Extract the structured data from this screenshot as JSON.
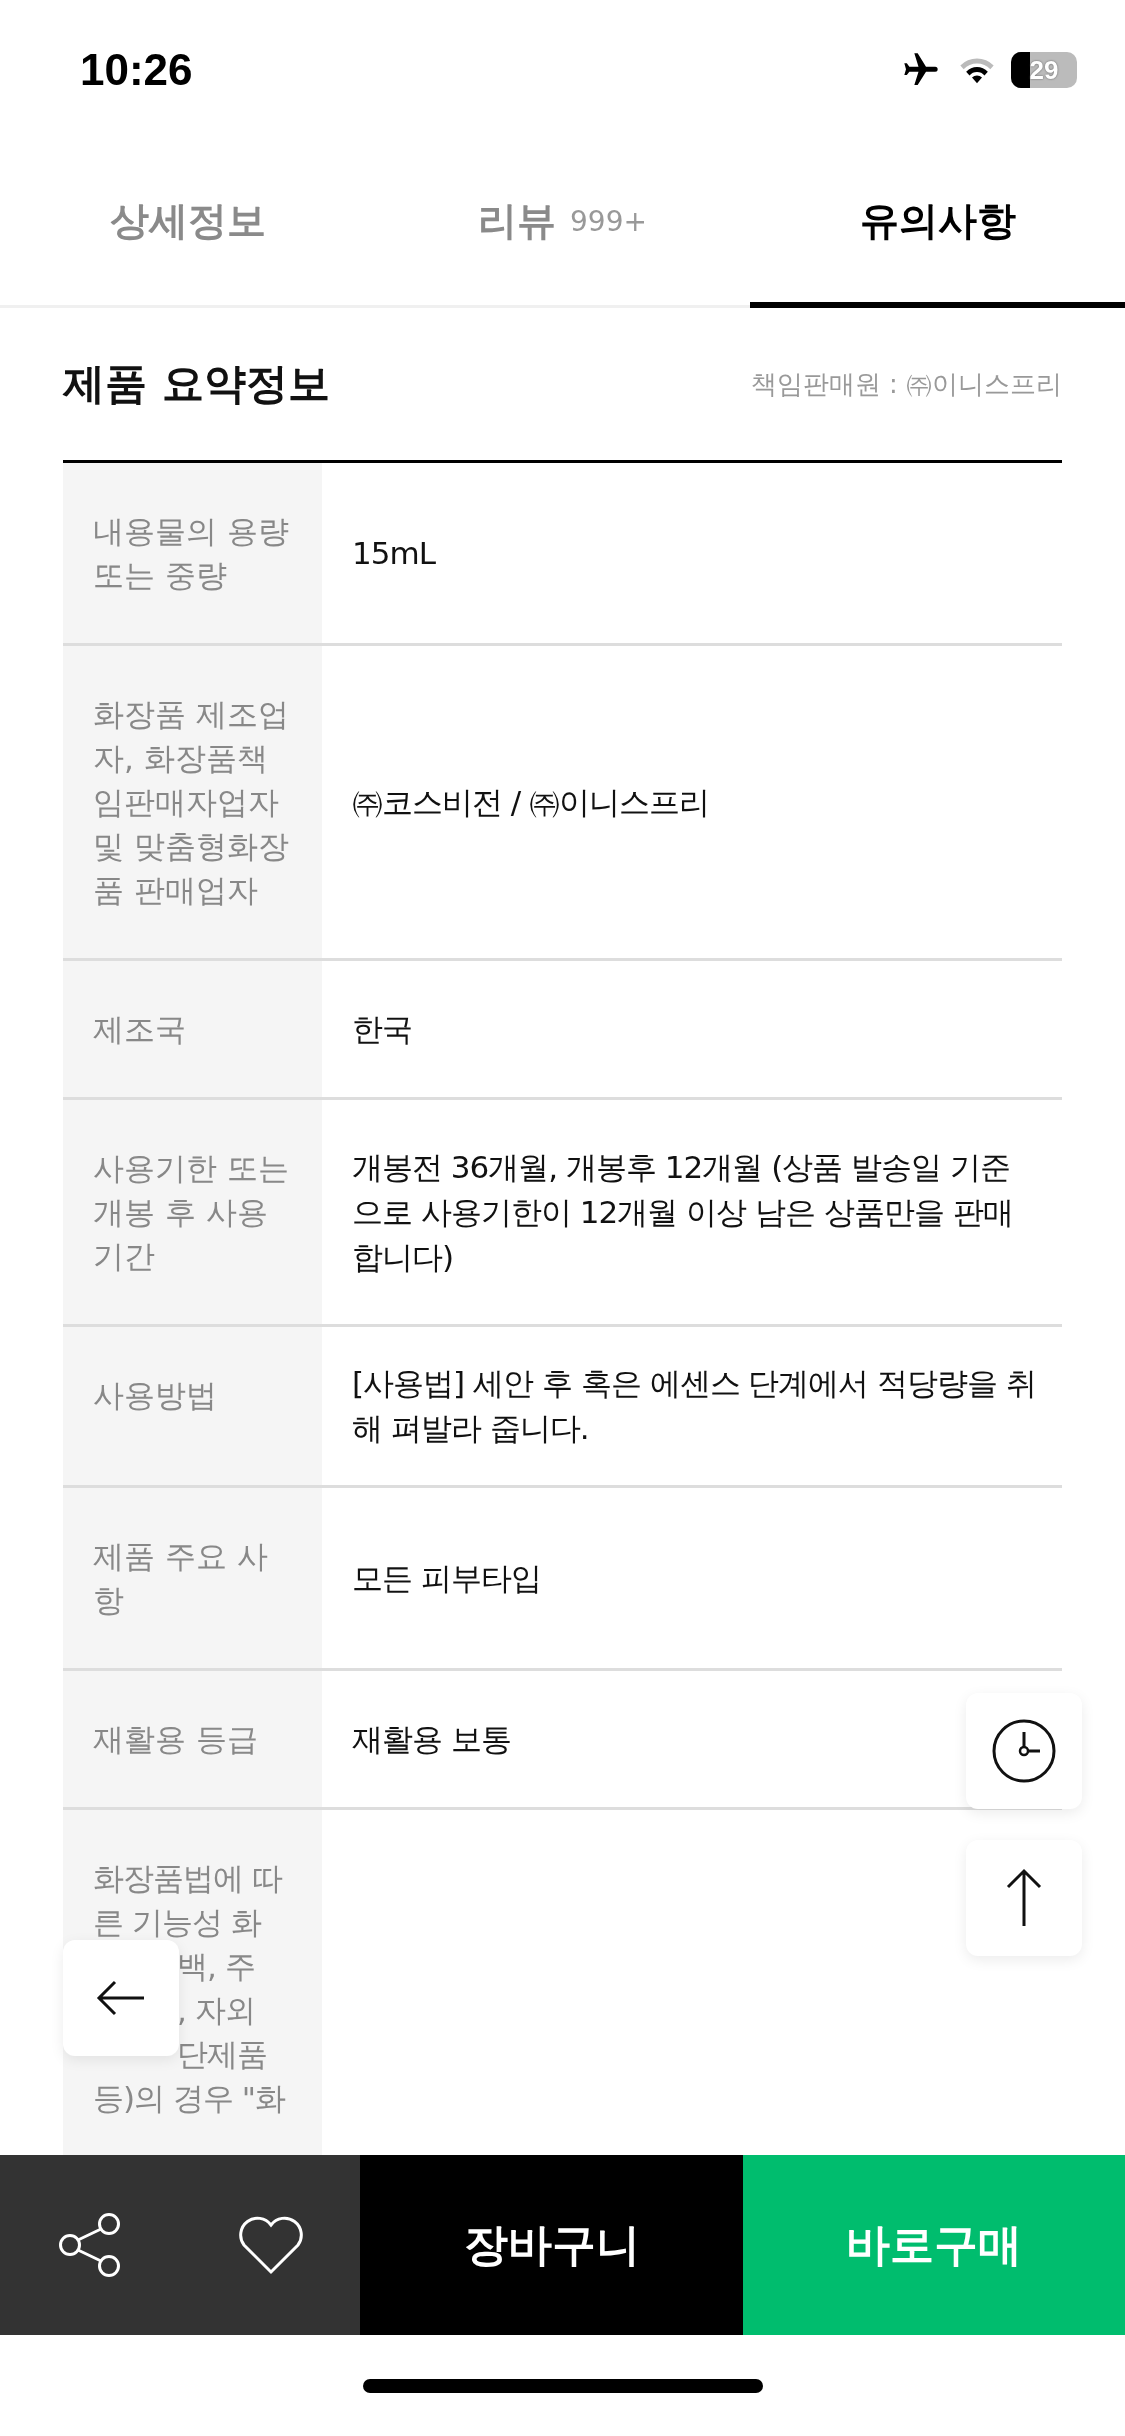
{
  "status_bar": {
    "time": "10:26",
    "battery": "29"
  },
  "tabs": [
    {
      "label": "상세정보",
      "selected": false
    },
    {
      "label": "리뷰",
      "count": "999+",
      "selected": false
    },
    {
      "label": "유의사항",
      "selected": true
    }
  ],
  "section": {
    "title": "제품 요약정보",
    "seller": "책임판매원 : ㈜이니스프리"
  },
  "rows": [
    {
      "label": [
        "내용물의 용량",
        "또는 중량"
      ],
      "value": "15mL"
    },
    {
      "label": [
        "화장품 제조업",
        "자, 화장품책",
        "임판매자업자",
        "및 맞춤형화장",
        "품 판매업자"
      ],
      "value": "㈜코스비전 / ㈜이니스프리"
    },
    {
      "label": [
        "제조국"
      ],
      "value": "한국"
    },
    {
      "label": [
        "사용기한 또는",
        "개봉 후 사용",
        "기간"
      ],
      "value": "개봉전 36개월, 개봉후 12개월 (상품 발송일 기준으로 사용기한이 12개월 이상 남은 상품만을 판매합니다)"
    },
    {
      "label": [
        "사용방법"
      ],
      "value": "[사용법] 세안 후 혹은 에센스 단계에서 적당량을 취해 펴발라 줍니다."
    },
    {
      "label": [
        "제품 주요 사",
        "항"
      ],
      "value": "모든 피부타입"
    },
    {
      "label": [
        "재활용 등급"
      ],
      "value": "재활용 보통"
    }
  ],
  "last_row": {
    "label_above_button": [
      "화장품법에 따",
      "른 기능성 화"
    ],
    "label_beside_button": [
      "백, 주",
      ", 자외",
      "단제품"
    ],
    "label_below_button": [
      "등)의 경우 \"화"
    ]
  },
  "bottom_bar": {
    "cart": "장바구니",
    "buy": "바로구매"
  }
}
